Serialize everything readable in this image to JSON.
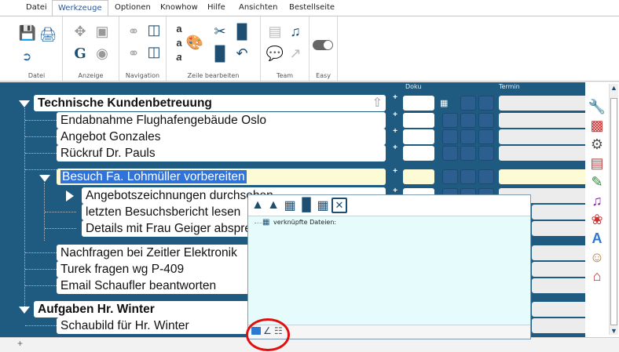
{
  "menu": [
    "Datei",
    "Werkzeuge",
    "Optionen",
    "Knowhow",
    "Hilfe",
    "Ansichten",
    "Bestellseite"
  ],
  "ribbon_groups": [
    "Datei",
    "Anzeige",
    "Navigation",
    "Zeile bearbeiten",
    "Team",
    "Easy"
  ],
  "columns": {
    "doku": "Doku",
    "termin": "Termin"
  },
  "tasks": [
    {
      "label": "Technische Kundenbetreuung"
    },
    {
      "label": "Endabnahme Flughafengebäude Oslo"
    },
    {
      "label": "Angebot Gonzales"
    },
    {
      "label": "Rückruf Dr. Pauls"
    },
    {
      "label": "Besuch Fa. Lohmüller vorbereiten"
    },
    {
      "label": "Angebotszeichnungen durchsehen"
    },
    {
      "label": "letzten Besuchsbericht lesen"
    },
    {
      "label": "Details mit Frau Geiger absprechen"
    },
    {
      "label": "Nachfragen bei Zeitler Elektronik"
    },
    {
      "label": "Turek fragen wg P-409"
    },
    {
      "label": "Email Schaufler beantworten"
    },
    {
      "label": "Aufgaben Hr. Winter"
    },
    {
      "label": "Schaubild für Hr. Winter"
    }
  ],
  "popup": {
    "tree_label": "verknüpfte Dateien:"
  },
  "icons": {
    "ribbon": [
      "save-icon",
      "print-icon",
      "exit-icon",
      "move-icon",
      "view-icon",
      "font-icon",
      "camera-icon",
      "link-icon",
      "nav-expand-icon",
      "nav-collapse-icon",
      "nav-icon",
      "sort-az-icon",
      "sort-za-icon",
      "italic-icon",
      "palette-icon",
      "cut-icon",
      "copy-icon",
      "paste-icon",
      "undo-icon",
      "contacts-icon",
      "team-icon",
      "chat-icon",
      "share-icon",
      "toggle-icon"
    ],
    "sidebar": [
      "tools-icon",
      "transfer-icon",
      "robot-icon",
      "books-icon",
      "edit-icon",
      "music-icon",
      "flower-icon",
      "letter-a-icon",
      "person-icon",
      "home-icon"
    ],
    "popup": [
      "move-up-icon",
      "move-top-icon",
      "delete-icon",
      "copy-icon",
      "grid-icon",
      "close-icon",
      "folder-icon",
      "pencil-icon",
      "globe-icon"
    ]
  },
  "colors": {
    "panel": "#1f5b80",
    "row_bg": "#ffffff",
    "highlight_bg": "#fdfbd6",
    "highlight_text": "#2a6fd6",
    "square": "#2c5f90",
    "annotation": "#e01010"
  }
}
